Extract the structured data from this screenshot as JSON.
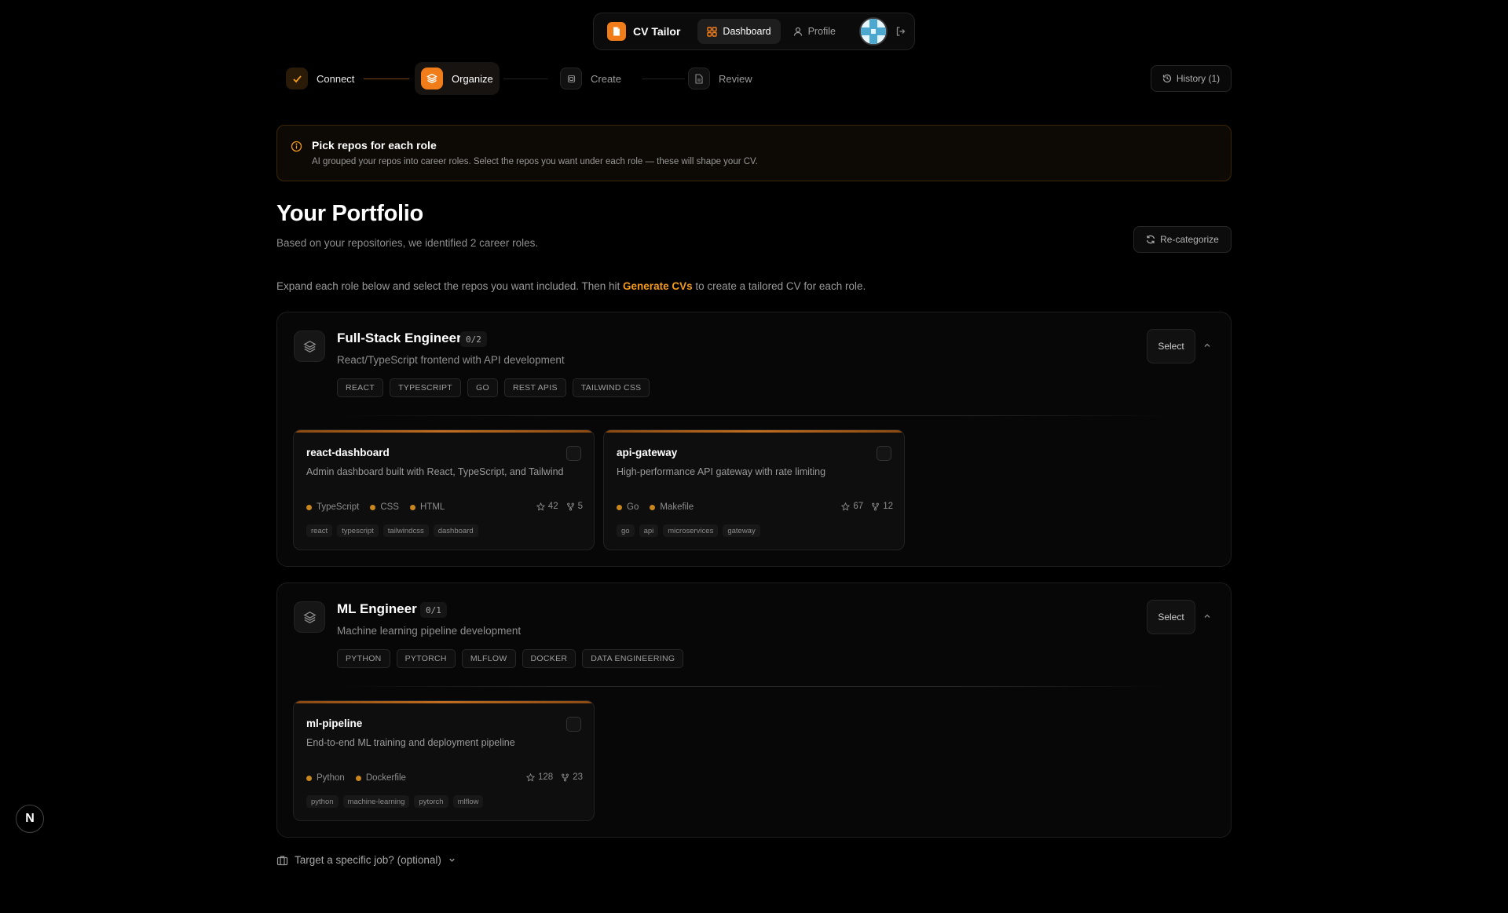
{
  "nav": {
    "brand": "CV Tailor",
    "dashboard_label": "Dashboard",
    "profile_label": "Profile"
  },
  "stepper": {
    "steps": [
      {
        "label": "Connect",
        "state": "done"
      },
      {
        "label": "Organize",
        "state": "active"
      },
      {
        "label": "Create",
        "state": "pending"
      },
      {
        "label": "Review",
        "state": "pending"
      }
    ],
    "history_label": "History (1)"
  },
  "banner": {
    "title": "Pick repos for each role",
    "text": "AI grouped your repos into career roles. Select the repos you want under each role — these will shape your CV."
  },
  "portfolio": {
    "title": "Your Portfolio",
    "subtitle": "Based on your repositories, we identified 2 career roles.",
    "recategorize_label": "Re-categorize",
    "instruction_before": "Expand each role below and select the repos you want included. Then hit ",
    "instruction_highlight": "Generate CVs",
    "instruction_after": " to create a tailored CV for each role."
  },
  "roles": [
    {
      "name": "Full-Stack Engineer",
      "count": "0/2",
      "description": "React/TypeScript frontend with API development",
      "tags": [
        "REACT",
        "TYPESCRIPT",
        "GO",
        "REST APIS",
        "TAILWIND CSS"
      ],
      "select_label": "Select",
      "repos": [
        {
          "name": "react-dashboard",
          "description": "Admin dashboard built with React, TypeScript, and Tailwind",
          "languages": [
            "TypeScript",
            "CSS",
            "HTML"
          ],
          "stars": "42",
          "forks": "5",
          "topics": [
            "react",
            "typescript",
            "tailwindcss",
            "dashboard"
          ]
        },
        {
          "name": "api-gateway",
          "description": "High-performance API gateway with rate limiting",
          "languages": [
            "Go",
            "Makefile"
          ],
          "stars": "67",
          "forks": "12",
          "topics": [
            "go",
            "api",
            "microservices",
            "gateway"
          ]
        }
      ]
    },
    {
      "name": "ML Engineer",
      "count": "0/1",
      "description": "Machine learning pipeline development",
      "tags": [
        "PYTHON",
        "PYTORCH",
        "MLFLOW",
        "DOCKER",
        "DATA ENGINEERING"
      ],
      "select_label": "Select",
      "repos": [
        {
          "name": "ml-pipeline",
          "description": "End-to-end ML training and deployment pipeline",
          "languages": [
            "Python",
            "Dockerfile"
          ],
          "stars": "128",
          "forks": "23",
          "topics": [
            "python",
            "machine-learning",
            "pytorch",
            "mlflow"
          ]
        }
      ]
    }
  ],
  "target_job_label": "Target a specific job? (optional)",
  "dev_badge": "N",
  "colors": {
    "accent": "#f07d1a",
    "highlight": "#f39a1d",
    "background": "#000000",
    "language_dot": "#c8861c"
  }
}
